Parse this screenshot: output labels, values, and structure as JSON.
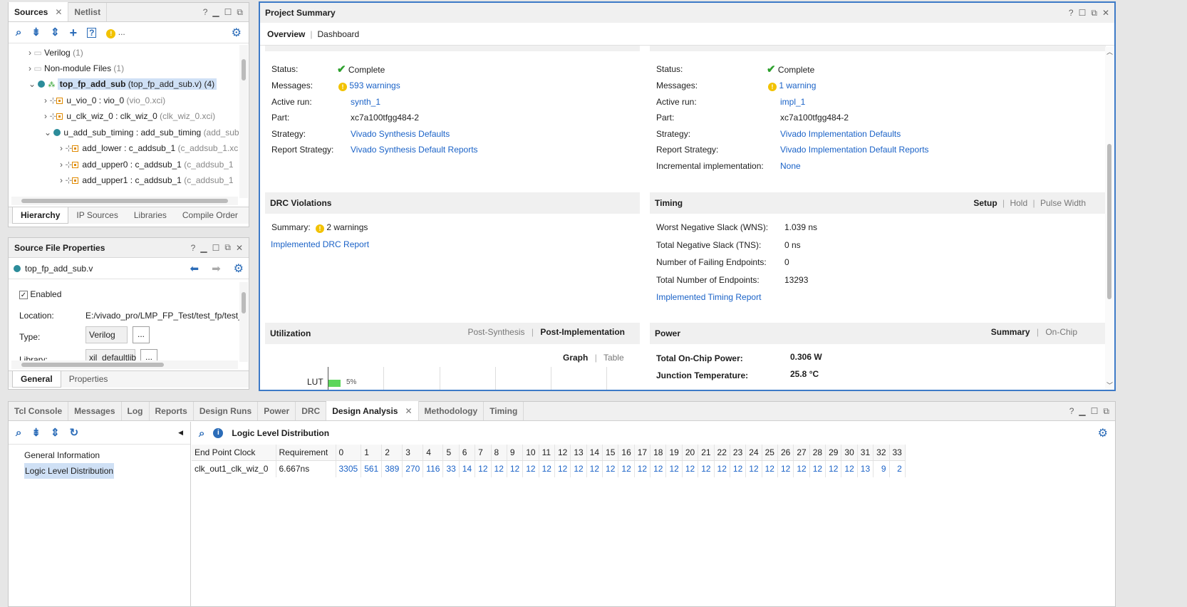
{
  "sources_panel": {
    "tabs": [
      "Sources",
      "Netlist"
    ],
    "toolbar_more": "...",
    "tree": [
      {
        "label": "Verilog",
        "count": "(1)"
      },
      {
        "label": "Non-module Files",
        "count": "(1)"
      },
      {
        "label": "top_fp_add_sub",
        "detail": "(top_fp_add_sub.v) (4)"
      },
      {
        "label": "u_vio_0 : vio_0",
        "detail": "(vio_0.xci)"
      },
      {
        "label": "u_clk_wiz_0 : clk_wiz_0",
        "detail": "(clk_wiz_0.xci)"
      },
      {
        "label": "u_add_sub_timing : add_sub_timing",
        "detail": "(add_sub"
      },
      {
        "label": "add_lower : c_addsub_1",
        "detail": "(c_addsub_1.xc"
      },
      {
        "label": "add_upper0 : c_addsub_1",
        "detail": "(c_addsub_1"
      },
      {
        "label": "add_upper1 : c_addsub_1",
        "detail": "(c_addsub_1"
      }
    ],
    "bottom_tabs": [
      "Hierarchy",
      "IP Sources",
      "Libraries",
      "Compile Order"
    ]
  },
  "file_props": {
    "title": "Source File Properties",
    "file": "top_fp_add_sub.v",
    "enabled_label": "Enabled",
    "location_label": "Location:",
    "location_value": "E:/vivado_pro/LMP_FP_Test/test_fp/test_f",
    "type_label": "Type:",
    "type_value": "Verilog",
    "library_label": "Library:",
    "library_value": "xil_defaultlib",
    "more": "...",
    "bottom_tabs": [
      "General",
      "Properties"
    ]
  },
  "summary": {
    "title": "Project Summary",
    "tabs": [
      "Overview",
      "Dashboard"
    ],
    "synth": {
      "status_label": "Status:",
      "status": "Complete",
      "messages_label": "Messages:",
      "messages": "593 warnings",
      "run_label": "Active run:",
      "run": "synth_1",
      "part_label": "Part:",
      "part": "xc7a100tfgg484-2",
      "strategy_label": "Strategy:",
      "strategy": "Vivado Synthesis Defaults",
      "report_label": "Report Strategy:",
      "report": "Vivado Synthesis Default Reports"
    },
    "impl": {
      "status_label": "Status:",
      "status": "Complete",
      "messages_label": "Messages:",
      "messages": "1 warning",
      "run_label": "Active run:",
      "run": "impl_1",
      "part_label": "Part:",
      "part": "xc7a100tfgg484-2",
      "strategy_label": "Strategy:",
      "strategy": "Vivado Implementation Defaults",
      "report_label": "Report Strategy:",
      "report": "Vivado Implementation Default Reports",
      "incr_label": "Incremental implementation:",
      "incr": "None"
    },
    "drc": {
      "title": "DRC Violations",
      "summary_label": "Summary:",
      "summary": "2 warnings",
      "report_link": "Implemented DRC Report"
    },
    "timing": {
      "title": "Timing",
      "modes": [
        "Setup",
        "Hold",
        "Pulse Width"
      ],
      "wns_label": "Worst Negative Slack (WNS):",
      "wns": "1.039 ns",
      "tns_label": "Total Negative Slack (TNS):",
      "tns": "0 ns",
      "fail_label": "Number of Failing Endpoints:",
      "fail": "0",
      "total_label": "Total Number of Endpoints:",
      "total": "13293",
      "report_link": "Implemented Timing Report"
    },
    "utilization": {
      "title": "Utilization",
      "modes": [
        "Post-Synthesis",
        "Post-Implementation"
      ],
      "views": [
        "Graph",
        "Table"
      ],
      "lut_label": "LUT",
      "lut_percent": "5%",
      "lut_fraction": 0.05
    },
    "power": {
      "title": "Power",
      "modes": [
        "Summary",
        "On-Chip"
      ],
      "total_label": "Total On-Chip Power:",
      "total": "0.306 W",
      "junction_label": "Junction Temperature:",
      "junction": "25.8 °C"
    }
  },
  "bottom": {
    "tabs": [
      "Tcl Console",
      "Messages",
      "Log",
      "Reports",
      "Design Runs",
      "Power",
      "DRC",
      "Design Analysis",
      "Methodology",
      "Timing"
    ],
    "nav": [
      "General Information",
      "Logic Level Distribution"
    ],
    "content_title": "Logic Level Distribution",
    "table": {
      "headers": [
        "End Point Clock",
        "Requirement",
        "0",
        "1",
        "2",
        "3",
        "4",
        "5",
        "6",
        "7",
        "8",
        "9",
        "10",
        "11",
        "12",
        "13",
        "14",
        "15",
        "16",
        "17",
        "18",
        "19",
        "20",
        "21",
        "22",
        "23",
        "24",
        "25",
        "26",
        "27",
        "28",
        "29",
        "30",
        "31",
        "32",
        "33"
      ],
      "row": [
        "clk_out1_clk_wiz_0",
        "6.667ns",
        "3305",
        "561",
        "389",
        "270",
        "116",
        "33",
        "14",
        "12",
        "12",
        "12",
        "12",
        "12",
        "12",
        "12",
        "12",
        "12",
        "12",
        "12",
        "12",
        "12",
        "12",
        "12",
        "12",
        "12",
        "12",
        "12",
        "12",
        "12",
        "12",
        "12",
        "12",
        "13",
        "9",
        "2"
      ]
    }
  },
  "colors": {
    "accent": "#2b6cb8",
    "link": "#1a62c7",
    "warning": "#f2c200",
    "ok": "#2ca02c",
    "bar": "#5cd65c"
  }
}
